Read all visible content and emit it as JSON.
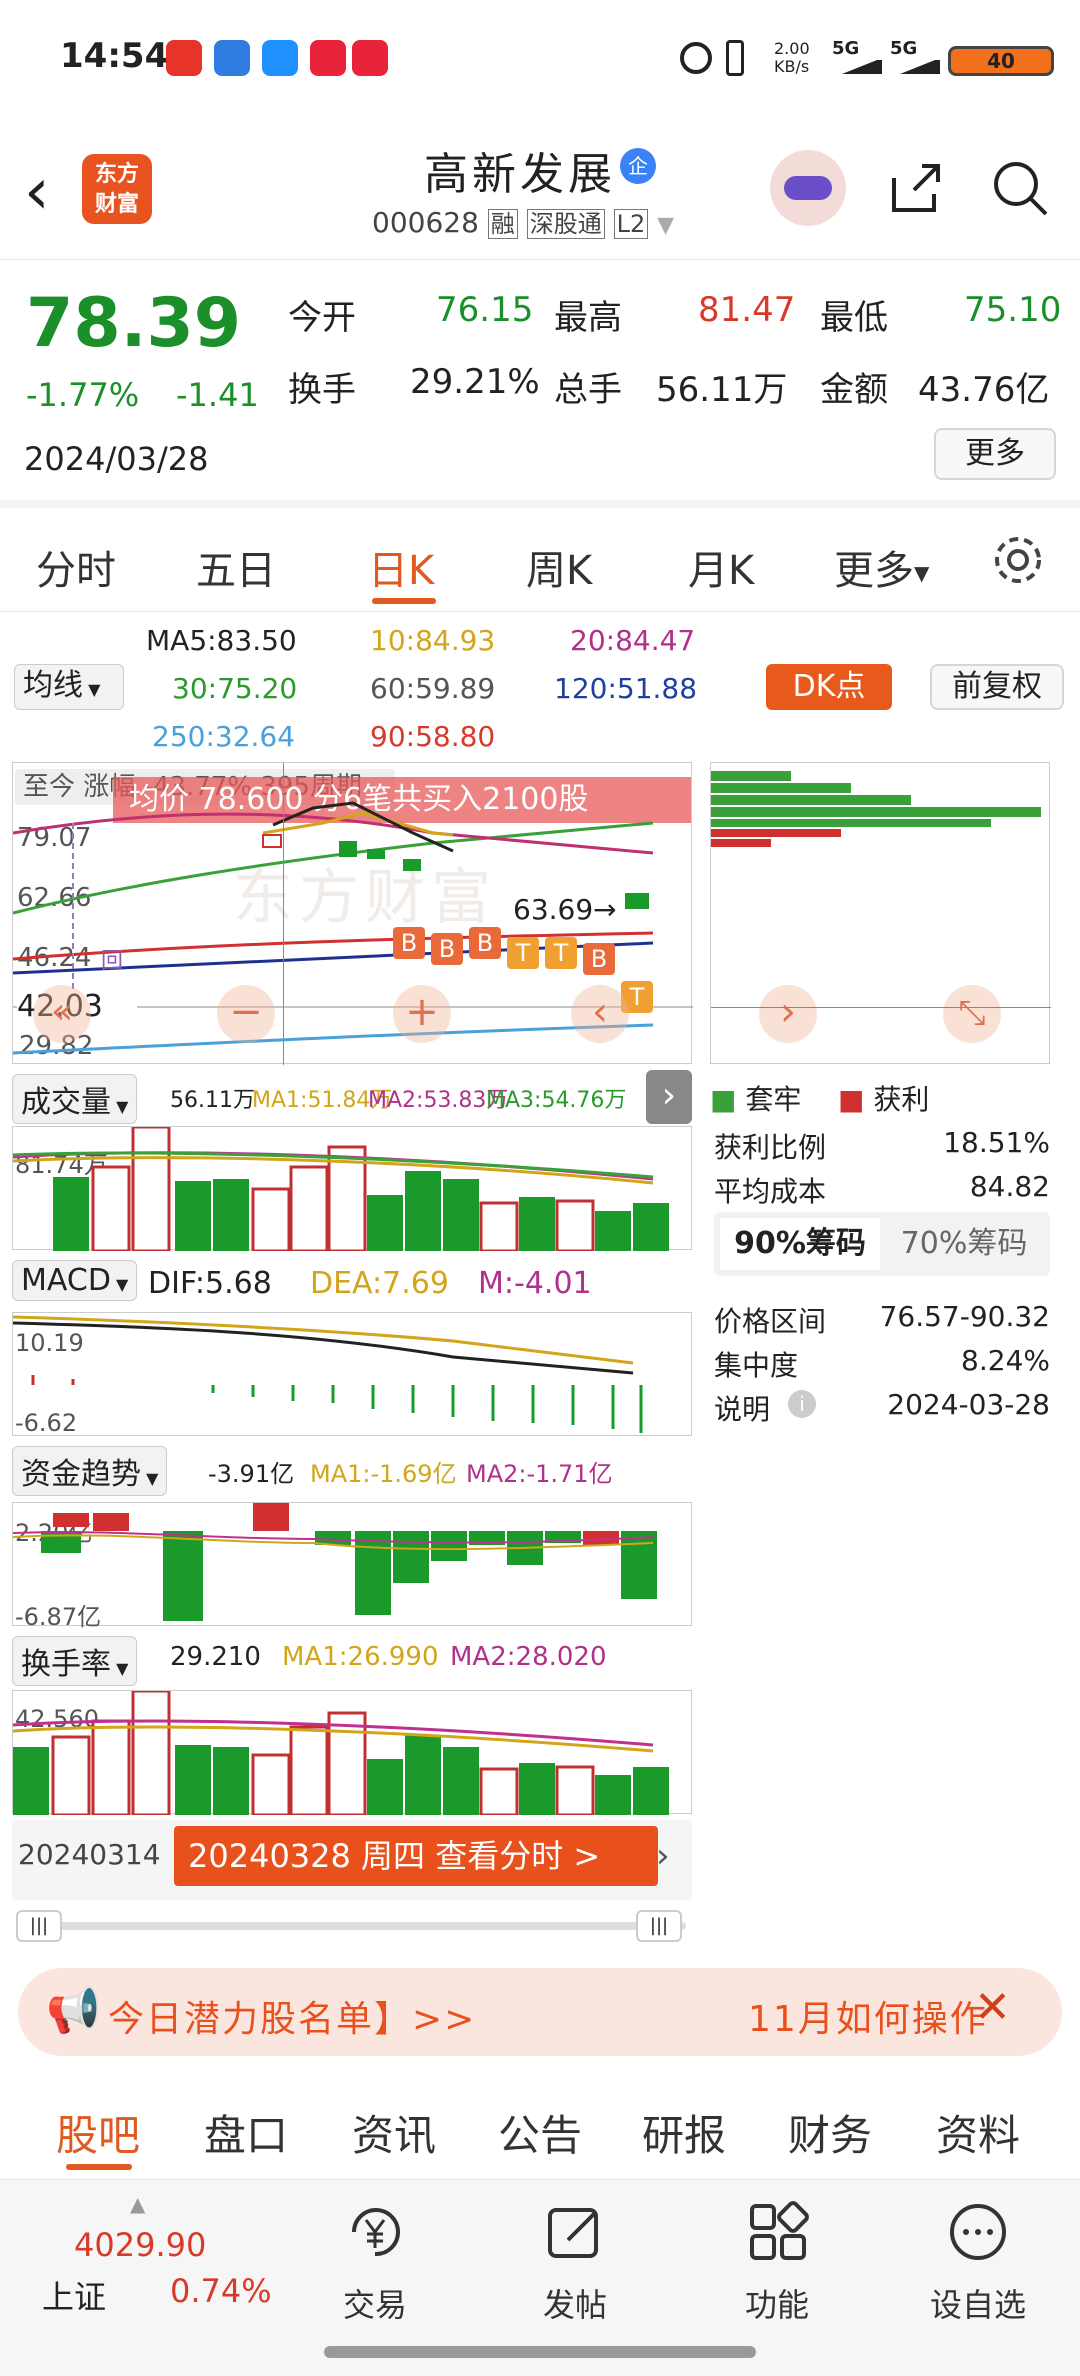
{
  "status_bar": {
    "time": "14:54",
    "net_speed_value": "2.00",
    "net_speed_unit": "KB/s",
    "sig1": "5G",
    "sig2": "5G",
    "battery": "40"
  },
  "header": {
    "logo_line1": "东方",
    "logo_line2": "财富",
    "name": "高新发展",
    "badge": "企",
    "code": "000628",
    "tag_rong": "融",
    "tag_sgt": "深股通",
    "tag_l2": "L2"
  },
  "quote": {
    "price": "78.39",
    "change_pct": "-1.77%",
    "change_val": "-1.41",
    "date": "2024/03/28",
    "open_label": "今开",
    "open": "76.15",
    "high_label": "最高",
    "high": "81.47",
    "low_label": "最低",
    "low": "75.10",
    "turnover_label": "换手",
    "turnover": "29.21%",
    "volume_label": "总手",
    "volume": "56.11万",
    "amount_label": "金额",
    "amount": "43.76亿",
    "more": "更多"
  },
  "tabs": {
    "t1": "分时",
    "t2": "五日",
    "t3": "日K",
    "t4": "周K",
    "t5": "月K",
    "t6": "更多"
  },
  "ma": {
    "select": "均线",
    "ma5": "MA5:83.50",
    "ma10": "10:84.93",
    "ma20": "20:84.47",
    "ma30": "30:75.20",
    "ma60": "60:59.89",
    "ma120": "120:51.88",
    "ma250": "250:32.64",
    "ma90": "90:58.80",
    "dk": "DK点",
    "fuquan": "前复权"
  },
  "kline": {
    "since": "至今 涨幅 -43.77% 395周期",
    "banner": "均价 78.600 分6笔共买入2100股",
    "y1": "79.07",
    "y2": "62.66",
    "y3": "46.24",
    "y4": "42.03",
    "y5": "29.82",
    "mark": "63.69",
    "tag_b": "B",
    "tag_t": "T",
    "tag_hui": "回",
    "watermark": "东方财富"
  },
  "chips": {
    "legend_trap": "套牢",
    "legend_profit": "获利",
    "profit_ratio_label": "获利比例",
    "profit_ratio": "18.51%",
    "avg_cost_label": "平均成本",
    "avg_cost": "84.82",
    "tab90": "90%筹码",
    "tab70": "70%筹码",
    "range_label": "价格区间",
    "range": "76.57-90.32",
    "concentration_label": "集中度",
    "concentration": "8.24%",
    "note_label": "说明",
    "note_date": "2024-03-28"
  },
  "vol": {
    "select": "成交量",
    "v": "56.11万",
    "ma1": "MA1:51.84万",
    "ma2": "MA2:53.83万",
    "ma3": "MA3:54.76万",
    "axis": "81.74万"
  },
  "macd": {
    "select": "MACD",
    "dif": "DIF:5.68",
    "dea": "DEA:7.69",
    "m": "M:-4.01",
    "top": "10.19",
    "bottom": "-6.62"
  },
  "fund": {
    "select": "资金趋势",
    "v": "-3.91亿",
    "ma1": "MA1:-1.69亿",
    "ma2": "MA2:-1.71亿",
    "top": "2.20亿",
    "bottom": "-6.87亿"
  },
  "turn": {
    "select": "换手率",
    "v": "29.210",
    "ma1": "MA1:26.990",
    "ma2": "MA2:28.020",
    "top": "42.560"
  },
  "timeline": {
    "start": "20240314",
    "btn": "20240328 周四 查看分时 >"
  },
  "promo": {
    "left": "今日潜力股名单】>>",
    "right": "11月如何操作"
  },
  "subtabs": {
    "s1": "股吧",
    "s2": "盘口",
    "s3": "资讯",
    "s4": "公告",
    "s5": "研报",
    "s6": "财务",
    "s7": "资料"
  },
  "bottom": {
    "index_val": "4029.90",
    "index_name": "上证",
    "index_pct": "0.74%",
    "trade": "交易",
    "post": "发帖",
    "func": "功能",
    "fav": "设自选"
  }
}
